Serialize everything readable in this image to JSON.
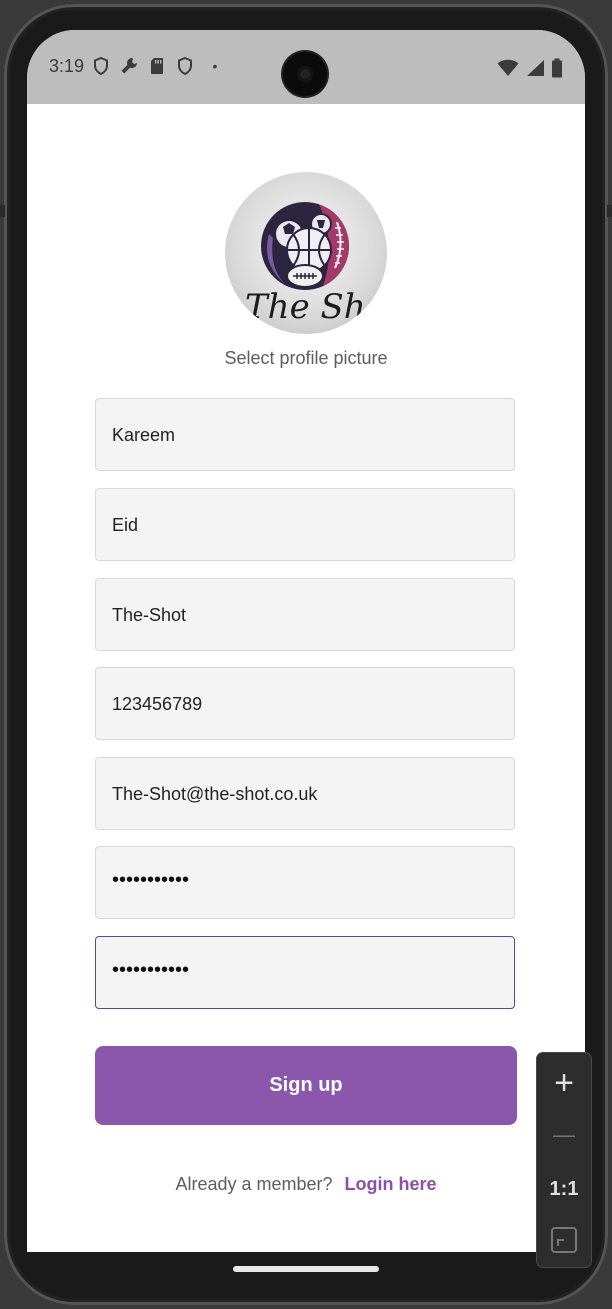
{
  "status_bar": {
    "time": "3:19",
    "icons_left": [
      "shield-icon",
      "wrench-icon",
      "sdcard-icon",
      "shield-icon"
    ],
    "dot": "•",
    "icons_right": [
      "wifi-icon",
      "signal-icon",
      "battery-icon"
    ]
  },
  "profile": {
    "logo_text": "The Shot",
    "select_label": "Select profile picture"
  },
  "form": {
    "first_name": "Kareem",
    "last_name": "Eid",
    "username": "The-Shot",
    "phone": "123456789",
    "email": "The-Shot@the-shot.co.uk",
    "password": "•••••••••••",
    "confirm_password": "•••••••••••"
  },
  "signup_label": "Sign up",
  "footer": {
    "question": "Already a member?",
    "login_link": "Login here"
  },
  "zoom_controls": {
    "plus": "+",
    "minus": "—",
    "ratio": "1:1"
  },
  "colors": {
    "accent": "#8b57ac",
    "link": "#8b4fae",
    "focus_border": "#6b3f8f"
  }
}
